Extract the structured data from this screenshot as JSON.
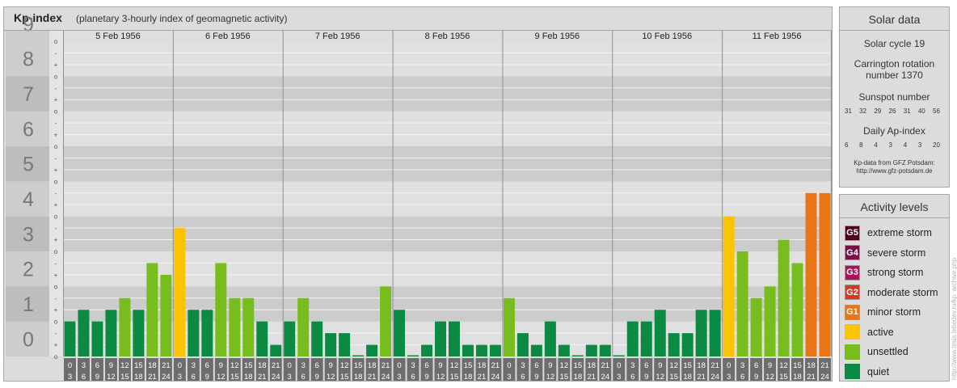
{
  "header": {
    "title": "Kp-index",
    "subtitle": "(planetary 3-hourly index of geomagnetic activity)"
  },
  "chart_data": {
    "type": "bar",
    "title": "Kp-index",
    "subtitle": "(planetary 3-hourly index of geomagnetic activity)",
    "ylim": [
      0,
      9
    ],
    "y_ticks": [
      "0",
      "1",
      "2",
      "3",
      "4",
      "5",
      "6",
      "7",
      "8",
      "9"
    ],
    "y_minor_ticks": [
      "+",
      "-",
      "o"
    ],
    "days": [
      "5 Feb 1956",
      "6 Feb 1956",
      "7 Feb 1956",
      "8 Feb 1956",
      "9 Feb 1956",
      "10 Feb 1956",
      "11 Feb 1956"
    ],
    "hour_bins_top": [
      "0",
      "3",
      "6",
      "9",
      "12",
      "15",
      "18",
      "21"
    ],
    "hour_bins_bottom": [
      "3",
      "6",
      "9",
      "12",
      "15",
      "18",
      "21",
      "24"
    ],
    "values": [
      [
        1.0,
        1.333,
        1.0,
        1.333,
        1.667,
        1.333,
        2.667,
        2.333
      ],
      [
        3.667,
        1.333,
        1.333,
        2.667,
        1.667,
        1.667,
        1.0,
        0.333
      ],
      [
        1.0,
        1.667,
        1.0,
        0.667,
        0.667,
        0.0,
        0.333,
        2.0
      ],
      [
        1.333,
        0.0,
        0.333,
        1.0,
        1.0,
        0.333,
        0.333,
        0.333
      ],
      [
        1.667,
        0.667,
        0.333,
        1.0,
        0.333,
        0.0,
        0.333,
        0.333
      ],
      [
        0.0,
        1.0,
        1.0,
        1.333,
        0.667,
        0.667,
        1.333,
        1.333
      ],
      [
        4.0,
        3.0,
        1.667,
        2.0,
        3.333,
        2.667,
        4.667,
        4.667
      ]
    ],
    "grid": true,
    "legend_position": "right"
  },
  "solar": {
    "title": "Solar data",
    "cycle": "Solar cycle 19",
    "carrington_line1": "Carrington rotation",
    "carrington_line2": "number 1370",
    "sunspot_title": "Sunspot number",
    "sunspot_values": [
      "31",
      "32",
      "29",
      "26",
      "31",
      "40",
      "56"
    ],
    "ap_title": "Daily Ap-index",
    "ap_values": [
      "6",
      "8",
      "4",
      "3",
      "4",
      "3",
      "20"
    ],
    "credit_line1": "Kp-data from GFZ Potsdam:",
    "credit_line2": "http://www.gfz-potsdam.de"
  },
  "legend": {
    "title": "Activity levels",
    "items": [
      {
        "badge": "G5",
        "label": "extreme storm",
        "color": "#4d0019"
      },
      {
        "badge": "G4",
        "label": "severe storm",
        "color": "#7a0f45"
      },
      {
        "badge": "G3",
        "label": "strong storm",
        "color": "#b0105a"
      },
      {
        "badge": "G2",
        "label": "moderate storm",
        "color": "#d03b22"
      },
      {
        "badge": "G1",
        "label": "minor storm",
        "color": "#e97517"
      },
      {
        "badge": "",
        "label": "active",
        "color": "#fcc300"
      },
      {
        "badge": "",
        "label": "unsettled",
        "color": "#76bd1d"
      },
      {
        "badge": "",
        "label": "quiet",
        "color": "#0b8a44"
      }
    ]
  },
  "watermark": "http://www.tesis.lebedev.ru/kp_archive.php"
}
